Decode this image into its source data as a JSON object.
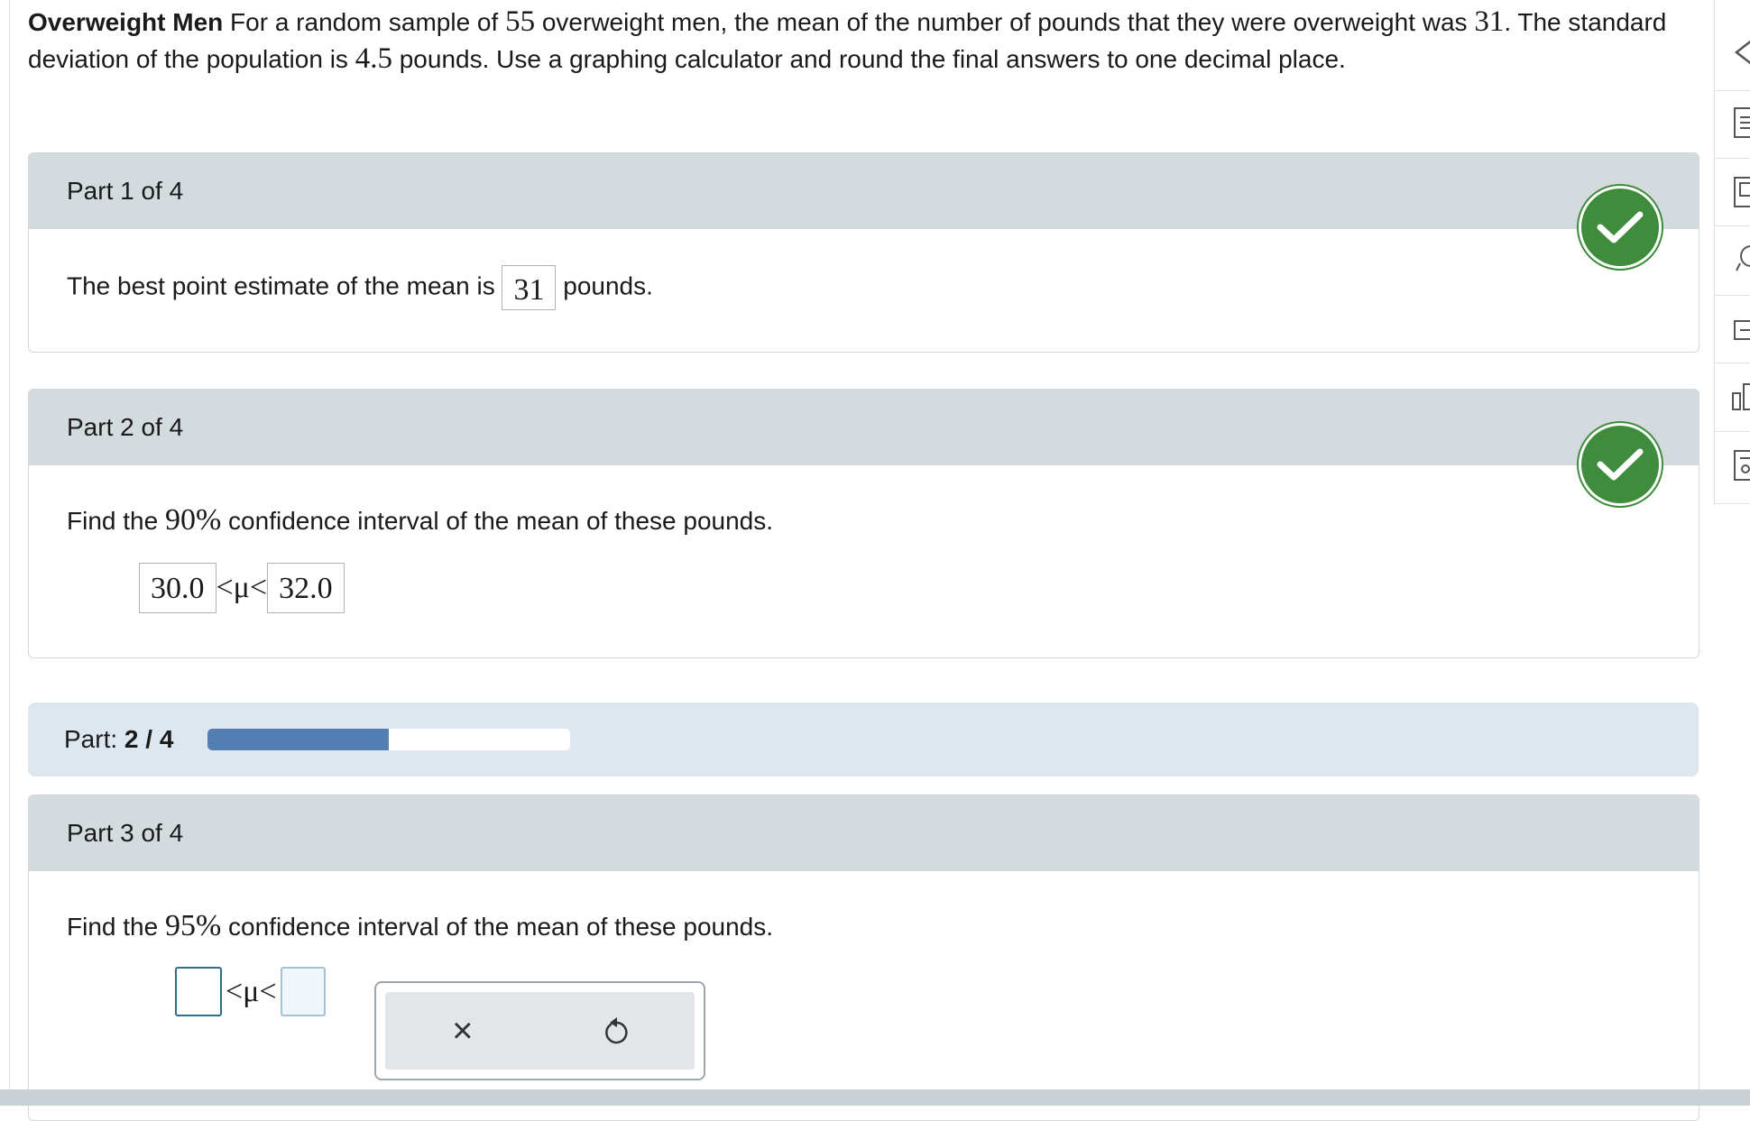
{
  "problem": {
    "title": "Overweight Men",
    "text_a": " For a random sample of ",
    "n": "55",
    "text_b": " overweight men, the mean of the number of pounds that they were overweight was ",
    "mean": "31",
    "text_c": ". The standard deviation of the population is ",
    "sd": "4.5",
    "text_d": " pounds. Use a graphing calculator and round the final answers to one decimal place."
  },
  "part1": {
    "header": "Part 1 of 4",
    "text_before": "The best point estimate of the mean is ",
    "answer": "31",
    "text_after": " pounds."
  },
  "part2": {
    "header": "Part 2 of 4",
    "text_before": "Find the ",
    "percent": "90%",
    "text_after": " confidence interval of the mean of these pounds.",
    "lower": "30.0",
    "inequality": "<μ<",
    "upper": "32.0"
  },
  "progress": {
    "label": "Part: ",
    "value": "2 / 4",
    "fraction": 0.5
  },
  "part3": {
    "header": "Part 3 of 4",
    "text_before": "Find the ",
    "percent": "95%",
    "text_after": " confidence interval of the mean of these pounds.",
    "inequality": "<μ<",
    "lower": "",
    "upper": ""
  },
  "palette": {
    "clear_symbol": "×"
  },
  "colors": {
    "check_green": "#3f8c3d",
    "progress_fill": "#527fb3",
    "header_bg": "#d4dbdf"
  },
  "icons": [
    "back-icon",
    "list-icon",
    "book-icon",
    "help-icon",
    "print-icon",
    "chart-icon",
    "calculator-icon",
    "checkmark-icon",
    "undo-icon"
  ]
}
